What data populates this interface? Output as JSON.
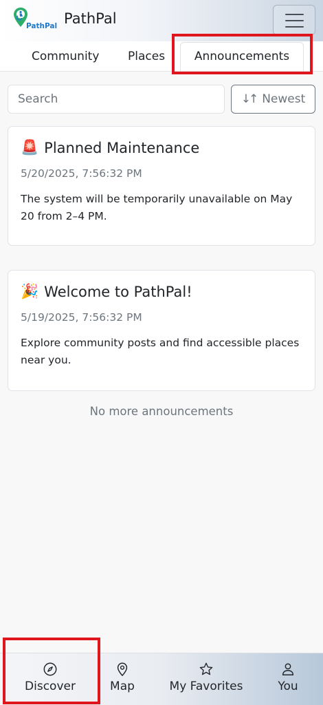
{
  "header": {
    "logo_text": "PathPal",
    "title": "PathPal",
    "menu_icon": "hamburger-icon"
  },
  "tabs": [
    {
      "label": "Community",
      "active": false
    },
    {
      "label": "Places",
      "active": false
    },
    {
      "label": "Announcements",
      "active": true
    }
  ],
  "toolbar": {
    "search_placeholder": "Search",
    "sort_label": "Newest",
    "sort_icon": "sort-arrows-icon"
  },
  "announcements": [
    {
      "icon": "siren-emoji",
      "emoji": "🚨",
      "title": "Planned Maintenance",
      "date": "5/20/2025, 7:56:32 PM",
      "body": "The system will be temporarily unavailable on May 20 from 2–4 PM."
    },
    {
      "icon": "party-popper-emoji",
      "emoji": "🎉",
      "title": "Welcome to PathPal!",
      "date": "5/19/2025, 7:56:32 PM",
      "body": "Explore community posts and find accessible places near you."
    }
  ],
  "end_message": "No more announcements",
  "bottom_nav": [
    {
      "label": "Discover",
      "icon": "compass-icon",
      "active": true
    },
    {
      "label": "Map",
      "icon": "map-pin-icon",
      "active": false
    },
    {
      "label": "My Favorites",
      "icon": "star-icon",
      "active": false
    },
    {
      "label": "You",
      "icon": "person-icon",
      "active": false
    }
  ],
  "colors": {
    "highlight": "#e0161e",
    "logo_green": "#2fae6b",
    "logo_blue": "#1f78c8",
    "muted_text": "#6c757d"
  }
}
